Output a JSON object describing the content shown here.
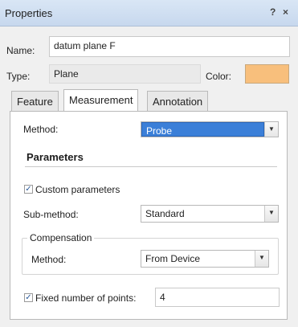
{
  "window": {
    "title": "Properties",
    "help_glyph": "?",
    "close_glyph": "×"
  },
  "general": {
    "name_label": "Name:",
    "name_value": "datum plane F",
    "type_label": "Type:",
    "type_value": "Plane",
    "color_label": "Color:",
    "color_value": "#f8bf7c"
  },
  "tabs": [
    {
      "label": "Feature",
      "active": false
    },
    {
      "label": "Measurement",
      "active": true
    },
    {
      "label": "Annotation",
      "active": false
    }
  ],
  "measurement": {
    "method_label": "Method:",
    "method_value": "Probe",
    "parameters_heading": "Parameters",
    "custom_parameters_label": "Custom parameters",
    "custom_parameters_checked": true,
    "sub_method_label": "Sub-method:",
    "sub_method_value": "Standard",
    "compensation": {
      "title": "Compensation",
      "method_label": "Method:",
      "method_value": "From Device"
    },
    "fixed_points_label": "Fixed number of points:",
    "fixed_points_checked": true,
    "fixed_points_value": "4"
  },
  "icons": {
    "checkmark": "✓",
    "dropdown_arrow": "▼"
  }
}
